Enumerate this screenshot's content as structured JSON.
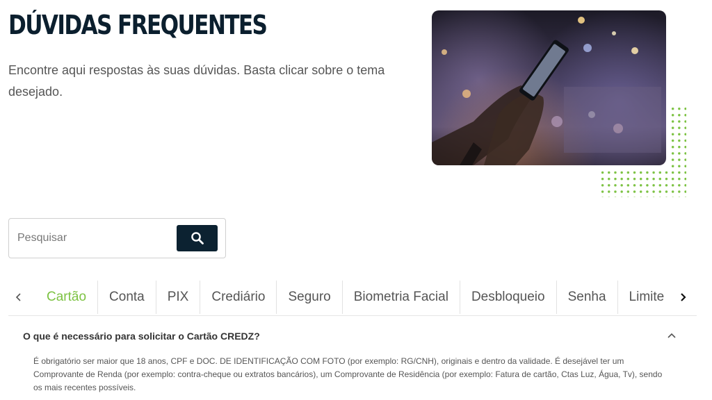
{
  "header": {
    "title": "DÚVIDAS FREQUENTES",
    "intro": "Encontre aqui respostas às suas dúvidas. Basta clicar sobre o tema desejado."
  },
  "hero": {
    "image": "hand-holding-smartphone-city-night"
  },
  "search": {
    "placeholder": "Pesquisar",
    "value": "",
    "icon": "search-icon"
  },
  "tabs": {
    "items": [
      {
        "label": "Cartão",
        "active": true
      },
      {
        "label": "Conta"
      },
      {
        "label": "PIX"
      },
      {
        "label": "Crediário"
      },
      {
        "label": "Seguro"
      },
      {
        "label": "Biometria Facial"
      },
      {
        "label": "Desbloqueio"
      },
      {
        "label": "Senha"
      },
      {
        "label": "Limite"
      }
    ],
    "prev_icon": "chevron-left-icon",
    "next_icon": "chevron-right-icon"
  },
  "faq": {
    "question": "O que é necessário para solicitar o Cartão CREDZ?",
    "answer": "É obrigatório ser maior que 18 anos, CPF e DOC. DE IDENTIFICAÇÃO COM FOTO (por exemplo: RG/CNH), originais e dentro da validade. É desejável ter um Comprovante de Renda (por exemplo: contra-cheque ou extratos bancários), um Comprovante de Residência (por exemplo: Fatura de cartão, Ctas Luz, Água, Tv), sendo os mais recentes possíveis.",
    "expanded": true,
    "toggle_icon": "chevron-up-icon"
  },
  "colors": {
    "navy": "#0b1f2e",
    "accent_green": "#7cc242",
    "text": "#555555"
  }
}
